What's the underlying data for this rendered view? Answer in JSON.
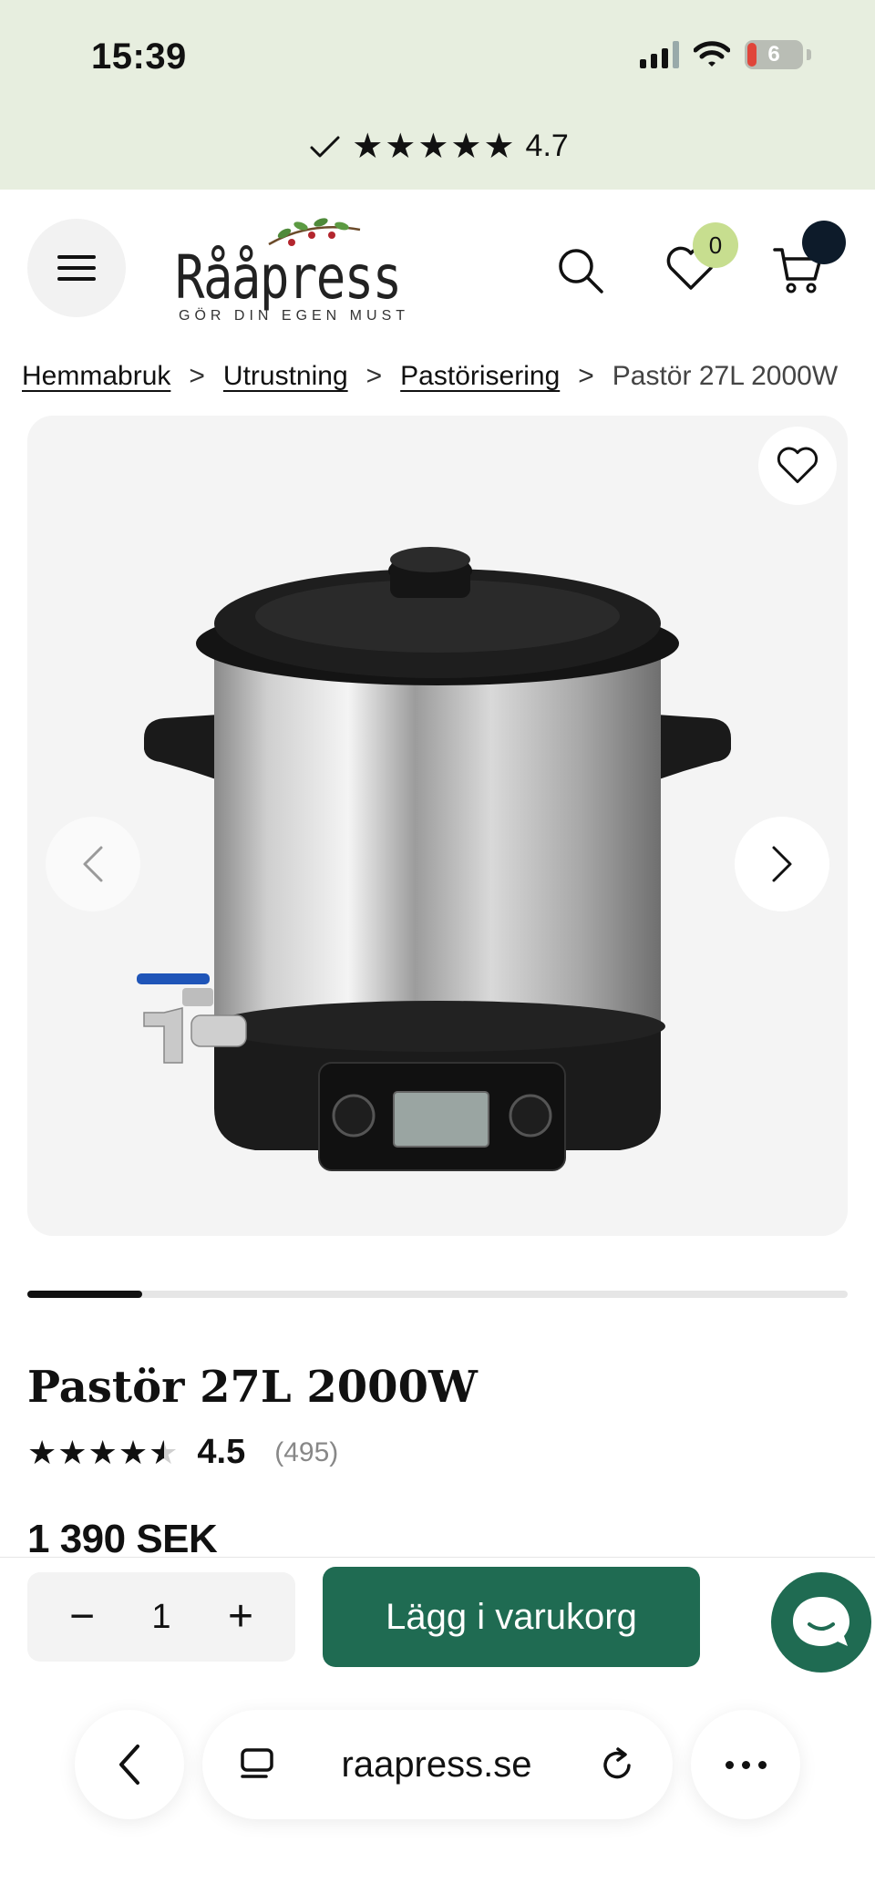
{
  "status_bar": {
    "time": "15:39",
    "battery": "6"
  },
  "trust_bar": {
    "stars": "★★★★★",
    "score": "4.7"
  },
  "header": {
    "logo_text": "Rååpress",
    "logo_tagline": "GÖR DIN EGEN MUST",
    "wishlist_count": "0"
  },
  "breadcrumb": {
    "items": [
      "Hemmabruk",
      "Utrustning",
      "Pastörisering"
    ],
    "current": "Pastör 27L 2000W",
    "separator": ">"
  },
  "gallery": {
    "image_count": 8,
    "current_index": 1,
    "progress": 0.14
  },
  "product": {
    "title": "Pastör 27L 2000W",
    "rating_stars": "★★★★★",
    "rating": 4.5,
    "rating_text": "4.5",
    "reviews": "(495)",
    "price": "1 390 SEK"
  },
  "cart": {
    "minus": "−",
    "plus": "+",
    "quantity": "1",
    "add_label": "Lägg i varukorg"
  },
  "browser": {
    "url": "raapress.se"
  },
  "colors": {
    "top_band": "#e7eedf",
    "accent": "#1f6b52",
    "badge": "#c7de8f"
  }
}
